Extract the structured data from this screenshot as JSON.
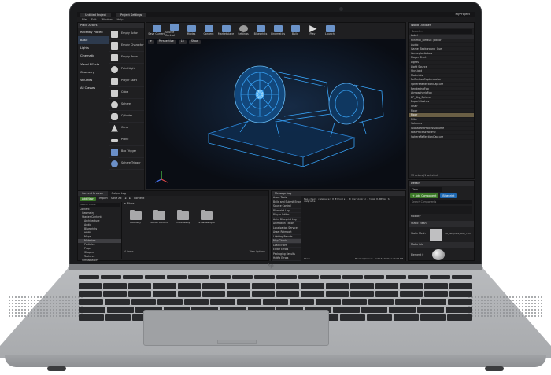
{
  "window": {
    "tabs": [
      "Untitled Project",
      "Project Settings"
    ],
    "project_name": "MyProject",
    "menu": [
      "File",
      "Edit",
      "Window",
      "Help"
    ],
    "mode_label": "Place Actors"
  },
  "toolbar": {
    "items": [
      "Save Current",
      "Source Control",
      "Modes",
      "Content",
      "Marketplace",
      "Settings",
      "Blueprints",
      "Cinematics",
      "Build",
      "Play",
      "Launch"
    ]
  },
  "place_panel": {
    "categories": [
      "Recently Placed",
      "Basic",
      "Lights",
      "Cinematic",
      "Visual Effects",
      "Geometry",
      "Volumes",
      "All Classes"
    ],
    "selected_category": "Basic",
    "items": [
      "Empty Actor",
      "Empty Character",
      "Empty Pawn",
      "Point Light",
      "Player Start",
      "Cube",
      "Sphere",
      "Cylinder",
      "Cone",
      "Plane",
      "Box Trigger",
      "Sphere Trigger"
    ]
  },
  "viewport": {
    "buttons": [
      "Perspective",
      "Lit",
      "Show"
    ]
  },
  "content_browser": {
    "tabs": [
      "Content Browser",
      "Output Log"
    ],
    "add_new": "Add New",
    "import": "Import",
    "save_all": "Save All",
    "path": "Content",
    "filters": "Filters",
    "search_placeholder": "Search Paths",
    "tree": [
      "Content",
      "Geometry",
      "Starter Content",
      "Architecture",
      "Audio",
      "Blueprints",
      "HDRI",
      "Maps",
      "Materials",
      "Particles",
      "Props",
      "Shapes",
      "Textures",
      "VirtualReality",
      "VirtualRealityBP"
    ],
    "selected_tree": "Materials",
    "assets": [
      "Geometry",
      "Starter Content",
      "VirtualReality",
      "VirtualRealityBP"
    ],
    "item_count": "4 items",
    "view_options": "View Options"
  },
  "message_log": {
    "title": "Message Log",
    "categories": [
      "Asset Tools",
      "Build and Submit Errors",
      "Source Control",
      "Blueprint Log",
      "Play in Editor",
      "Anim Blueprint Log",
      "Animation Editor",
      "Localization Service",
      "Asset Reimport",
      "Lighting Results",
      "Map Check",
      "Load Errors",
      "Editor Errors",
      "Packaging Results",
      "Hotfix Errors"
    ],
    "selected": "Map Check",
    "text": "Map check complete: 0 Error(s), 0 Warning(s), took 0.005ms to complete.",
    "show_label": "Show",
    "filter_label": "Minimal_Default - Oct 16, 2020, 1:27:08 PM"
  },
  "outliner": {
    "title": "World Outliner",
    "search_placeholder": "Search...",
    "column": "Label",
    "rows": [
      "Minimal_Default (Editor)",
      "Audio",
      "Game_Background_Cue",
      "GameplayActors",
      "Player Start",
      "Lights",
      "Light Source",
      "SkyLight",
      "Materials",
      "ReflectionCaptureActor",
      "SphereReflectionCapture",
      "RenderingFog",
      "AtmosphericFog",
      "BP_Sky_Sphere",
      "ExportMeshes",
      "Chair",
      "Floor",
      "Floor",
      "Pillar",
      "Volumes",
      "GlobalPostProcessVolume",
      "PostProcessVolume",
      "SphereReflectionCapture"
    ],
    "selected": "Floor",
    "status": "13 actors (1 selected)"
  },
  "details": {
    "title": "Details",
    "name_value": "Floor",
    "add_component": "+ Add Component",
    "blueprint": "Blueprint",
    "search_placeholder": "Search Components",
    "mobility_label": "Mobility",
    "static_mesh_section": "Static Mesh",
    "static_mesh_label": "Static Mesh",
    "static_mesh_value": "SM_Template_Map_Floor",
    "materials_section": "Materials",
    "element_label": "Element 0"
  },
  "colors": {
    "accent_green": "#3d7a29",
    "accent_blue": "#1d67b0",
    "selection": "#6a5f45",
    "hologram": "#39a8ff"
  }
}
